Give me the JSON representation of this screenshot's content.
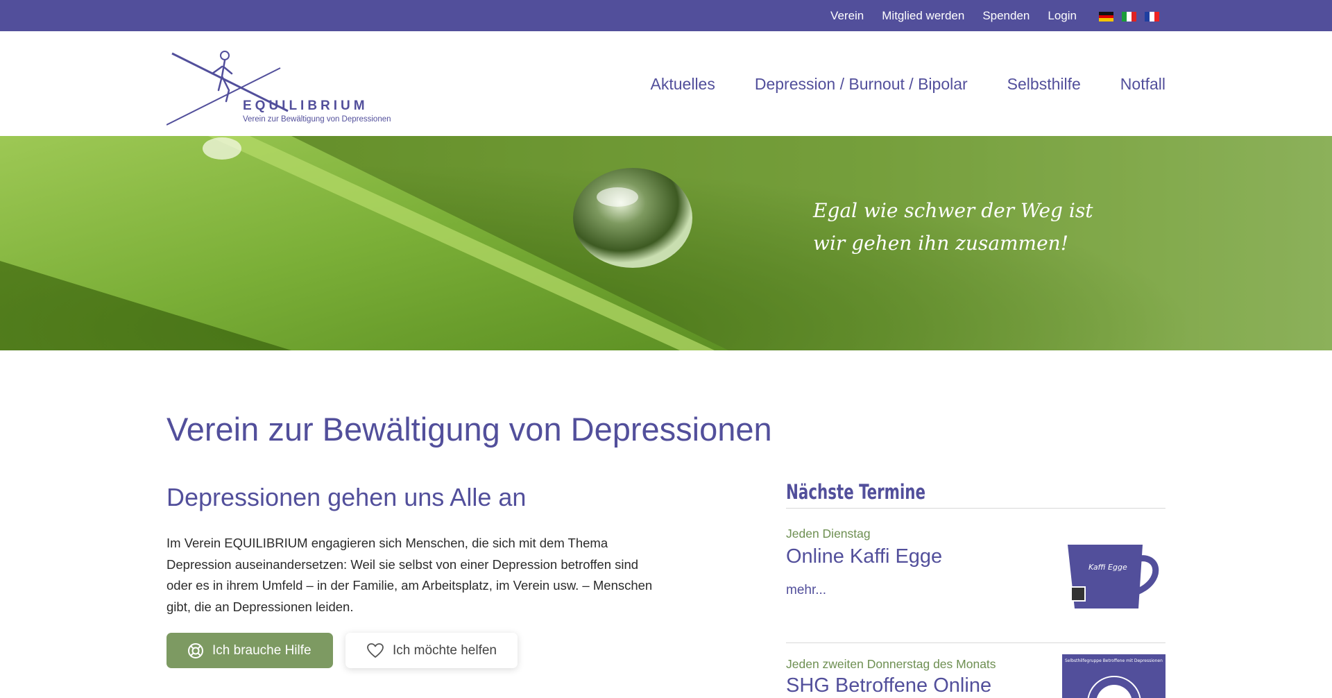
{
  "topnav": {
    "items": [
      {
        "label": "Verein"
      },
      {
        "label": "Mitglied werden"
      },
      {
        "label": "Spenden"
      },
      {
        "label": "Login"
      }
    ],
    "flags": [
      "de",
      "it",
      "fr"
    ]
  },
  "logo": {
    "name": "EQUILIBRIUM",
    "tagline": "Verein zur Bewältigung von Depressionen"
  },
  "mainnav": {
    "items": [
      {
        "label": "Aktuelles"
      },
      {
        "label": "Depression / Burnout / Bipolar"
      },
      {
        "label": "Selbsthilfe"
      },
      {
        "label": "Notfall"
      }
    ]
  },
  "hero": {
    "quote_line1": "Egal wie schwer der Weg ist",
    "quote_line2": "wir gehen ihn zusammen!"
  },
  "main": {
    "title": "Verein zur Bewältigung von Depressionen",
    "section_title": "Depressionen gehen uns Alle an",
    "intro": "Im Verein EQUILIBRIUM engagieren sich Menschen, die sich mit dem Thema Depression auseinandersetzen: Weil sie selbst von einer Depression betroffen sind oder es in ihrem Umfeld – in der Familie, am Arbeitsplatz, im Verein usw. – Menschen gibt, die an Depressionen leiden.",
    "btn_help": "Ich brauche Hilfe",
    "btn_give": "Ich möchte helfen"
  },
  "sidebar": {
    "title": "Nächste Termine",
    "events": [
      {
        "date": "Jeden Dienstag",
        "title": "Online Kaffi Egge",
        "more": "mehr...",
        "thumb_text": "Kaffi Egge"
      },
      {
        "date": "Jeden zweiten Donnerstag des Monats",
        "title": "SHG Betroffene Online",
        "thumb_text": "Selbsthilfegruppe Betroffene mit Depressionen"
      }
    ]
  },
  "colors": {
    "brand_purple": "#524f9b",
    "green_button": "#7d9a62",
    "green_text": "#6e8f52"
  }
}
